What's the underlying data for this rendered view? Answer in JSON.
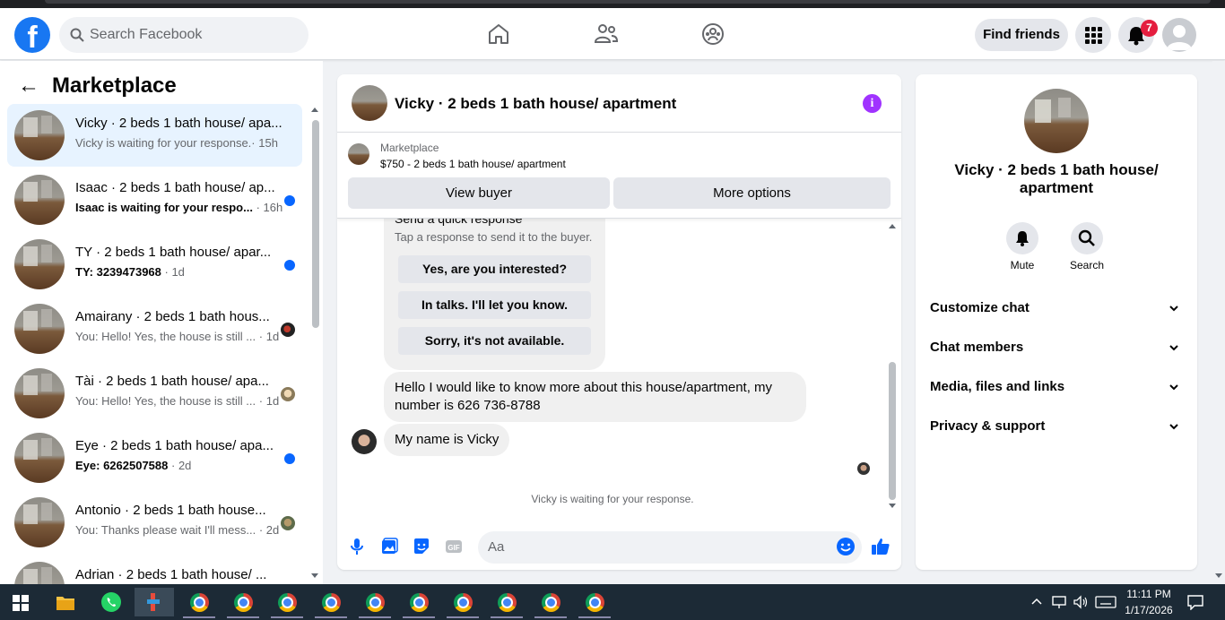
{
  "topbar": {
    "search_placeholder": "Search Facebook",
    "find_friends": "Find friends",
    "notification_count": "7",
    "logo_letter": "f"
  },
  "sidebar": {
    "title": "Marketplace",
    "conversations": [
      {
        "title": "Vicky · 2 beds 1 bath house/ apa...",
        "preview": "Vicky is waiting for your response.",
        "time": "· 15h",
        "unread": false,
        "active": true
      },
      {
        "title": "Isaac · 2 beds 1 bath house/ ap...",
        "preview": "Isaac is waiting for your respo...",
        "time": "· 16h",
        "unread": true
      },
      {
        "title": "TY · 2 beds 1 bath house/ apar...",
        "preview": "TY: 3239473968",
        "time": "· 1d",
        "unread": true
      },
      {
        "title": "Amairany · 2 beds 1 bath hous...",
        "preview": "You: Hello! Yes, the house is still ...",
        "time": "· 1d",
        "unread": false
      },
      {
        "title": "Tài · 2 beds 1 bath house/ apa...",
        "preview": "You: Hello! Yes, the house is still ...",
        "time": "· 1d",
        "unread": false
      },
      {
        "title": "Eye · 2 beds 1 bath house/ apa...",
        "preview": "Eye: 6262507588",
        "time": "· 2d",
        "unread": true
      },
      {
        "title": "Antonio · 2 beds 1 bath house...",
        "preview": "You: Thanks please wait I'll mess...",
        "time": "· 2d",
        "unread": false
      },
      {
        "title": "Adrian · 2 beds 1 bath house/ ...",
        "preview": "",
        "time": "",
        "unread": false
      }
    ]
  },
  "chat": {
    "title": "Vicky · 2 beds 1 bath house/ apartment",
    "marketplace_label": "Marketplace",
    "listing": "$750 - 2 beds 1 bath house/ apartment",
    "view_buyer": "View buyer",
    "more_options": "More options",
    "quick_title": "Send a quick response",
    "quick_sub": "Tap a response to send it to the buyer.",
    "quick_replies": [
      "Yes, are you interested?",
      "In talks. I'll let you know.",
      "Sorry, it's not available."
    ],
    "message1": "Hello I would like to know more about this house/apartment, my number is 626 736-8788",
    "message2": "My name is Vicky",
    "waiting": "Vicky is waiting for your response.",
    "input_placeholder": "Aa"
  },
  "details": {
    "name": "Vicky · 2 beds 1 bath house/ apartment",
    "mute": "Mute",
    "search": "Search",
    "sections": [
      "Customize chat",
      "Chat members",
      "Media, files and links",
      "Privacy & support"
    ]
  },
  "taskbar": {
    "time": "11:11 PM",
    "date": "1/17/2026"
  },
  "colors": {
    "brand": "#1877f2",
    "unread_dot": "#0866ff",
    "info": "#a033ff"
  }
}
